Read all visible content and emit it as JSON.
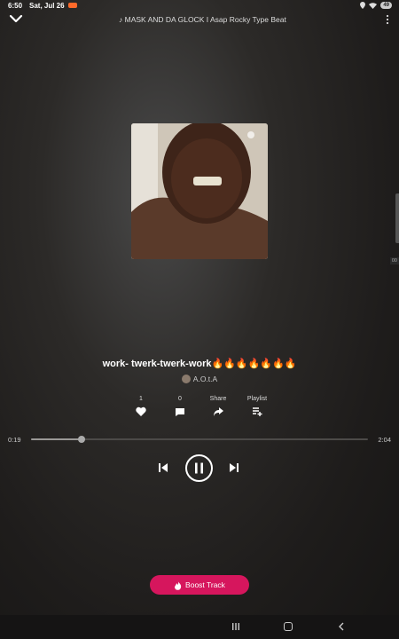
{
  "status_bar": {
    "time": "6:50",
    "date": "Sat, Jul 26",
    "battery": "49"
  },
  "header": {
    "track_title": "MASK AND DA GLOCK I Asap Rocky Type Beat",
    "music_note_icon": "music-note-icon",
    "collapse_icon": "chevron-down-icon",
    "more_icon": "more-vertical-icon"
  },
  "track": {
    "title": "work- twerk-twerk-work🔥🔥🔥🔥🔥🔥🔥",
    "artist": "A.O.t.A"
  },
  "actions": {
    "like_count": "1",
    "comment_count": "0",
    "share_label": "Share",
    "playlist_label": "Playlist"
  },
  "player": {
    "current_time": "0:19",
    "duration": "2:04",
    "progress": 0.15
  },
  "boost": {
    "label": "Boost Track"
  },
  "colors": {
    "accent": "#d6165d",
    "recording": "#ff6a2a"
  }
}
